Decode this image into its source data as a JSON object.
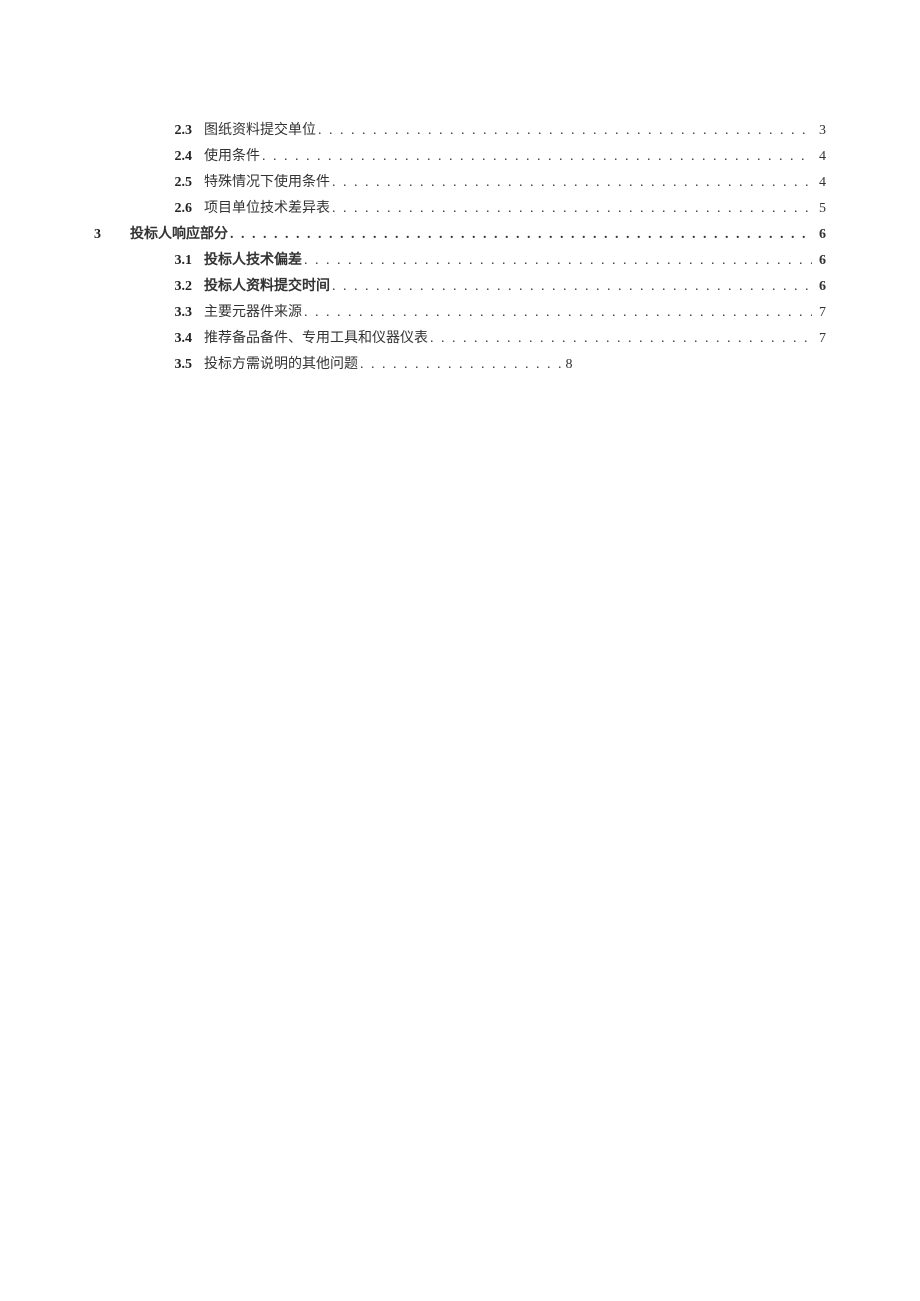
{
  "lines": [
    {
      "num": "2.3",
      "title": "图纸资料提交单位",
      "page": "3",
      "level": 2,
      "bold": false
    },
    {
      "num": "2.4",
      "title": "使用条件",
      "page": "4",
      "level": 2,
      "bold": false
    },
    {
      "num": "2.5",
      "title": "特殊情况下使用条件",
      "page": "4",
      "level": 2,
      "bold": false
    },
    {
      "num": "2.6",
      "title": "项目单位技术差异表",
      "page": "5",
      "level": 2,
      "bold": false
    },
    {
      "num": "3",
      "title": "投标人响应部分",
      "page": "6",
      "level": 1,
      "bold": true
    },
    {
      "num": "3.1",
      "title": "投标人技术偏差",
      "page": "6",
      "level": 2,
      "bold": true
    },
    {
      "num": "3.2",
      "title": "投标人资料提交时间",
      "page": "6",
      "level": 2,
      "bold": true
    },
    {
      "num": "3.3",
      "title": "主要元器件来源",
      "page": "7",
      "level": 2,
      "bold": false
    },
    {
      "num": "3.4",
      "title": "推荐备品备件、专用工具和仪器仪表",
      "page": "7",
      "level": 2,
      "bold": false
    },
    {
      "num": "3.5",
      "title": "投标方需说明的其他问题",
      "page": "8",
      "level": 2,
      "bold": false,
      "short": true
    }
  ],
  "dots": ". . . . . . . . . . . . . . . . . . . . . . . . . . . . . . . . . . . . . . . . . . . . . . . . . . . . . . . . . . . . . . . . . . . . . . . . . . . . . . . . . . . . . . . . . . . . . . . . . . . . . . . . . . . . . . . . . . . . . . . . . . . . . . . . . . . . . . . . . . . . . . . . . . . . . . . . . . . . . . . . . . . . . . . . . . . . . . . . . . . . . . . . . . . . . . . ."
}
